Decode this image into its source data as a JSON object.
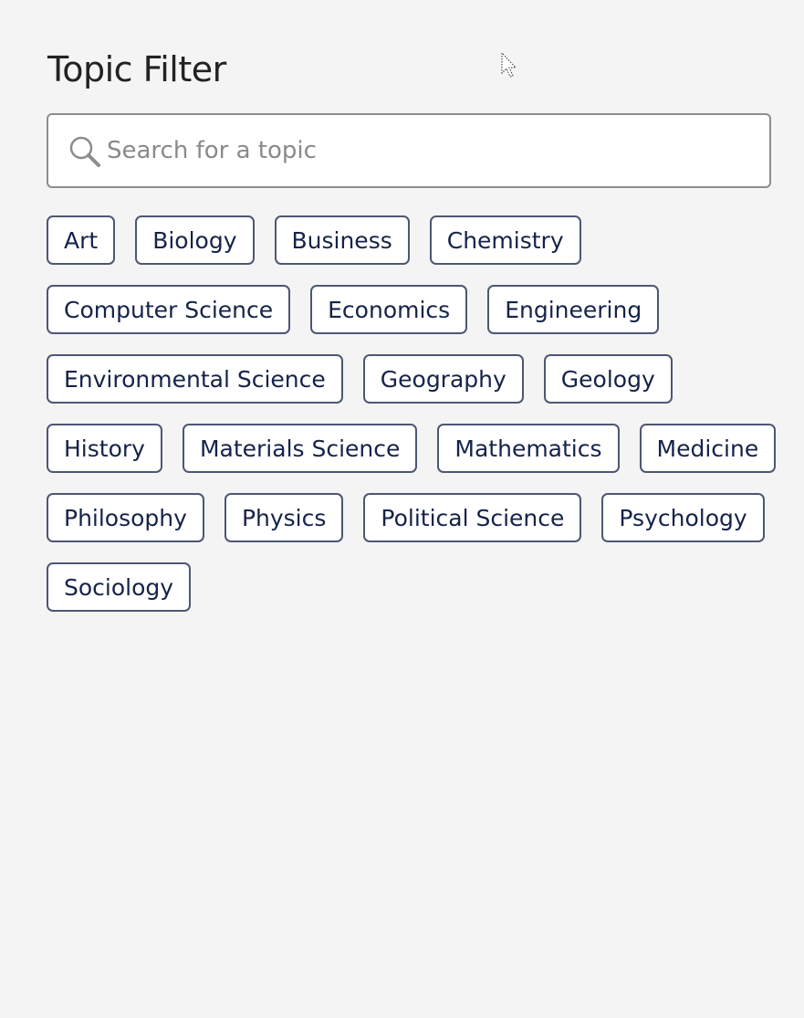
{
  "title": "Topic Filter",
  "search": {
    "placeholder": "Search for a topic",
    "value": "",
    "icon": "search-icon"
  },
  "topics": [
    "Art",
    "Biology",
    "Business",
    "Chemistry",
    "Computer Science",
    "Economics",
    "Engineering",
    "Environmental Science",
    "Geography",
    "Geology",
    "History",
    "Materials Science",
    "Mathematics",
    "Medicine",
    "Philosophy",
    "Physics",
    "Political Science",
    "Psychology",
    "Sociology"
  ],
  "colors": {
    "tag_border": "#4d5773",
    "tag_text": "#15234a",
    "background": "#f4f4f4"
  }
}
